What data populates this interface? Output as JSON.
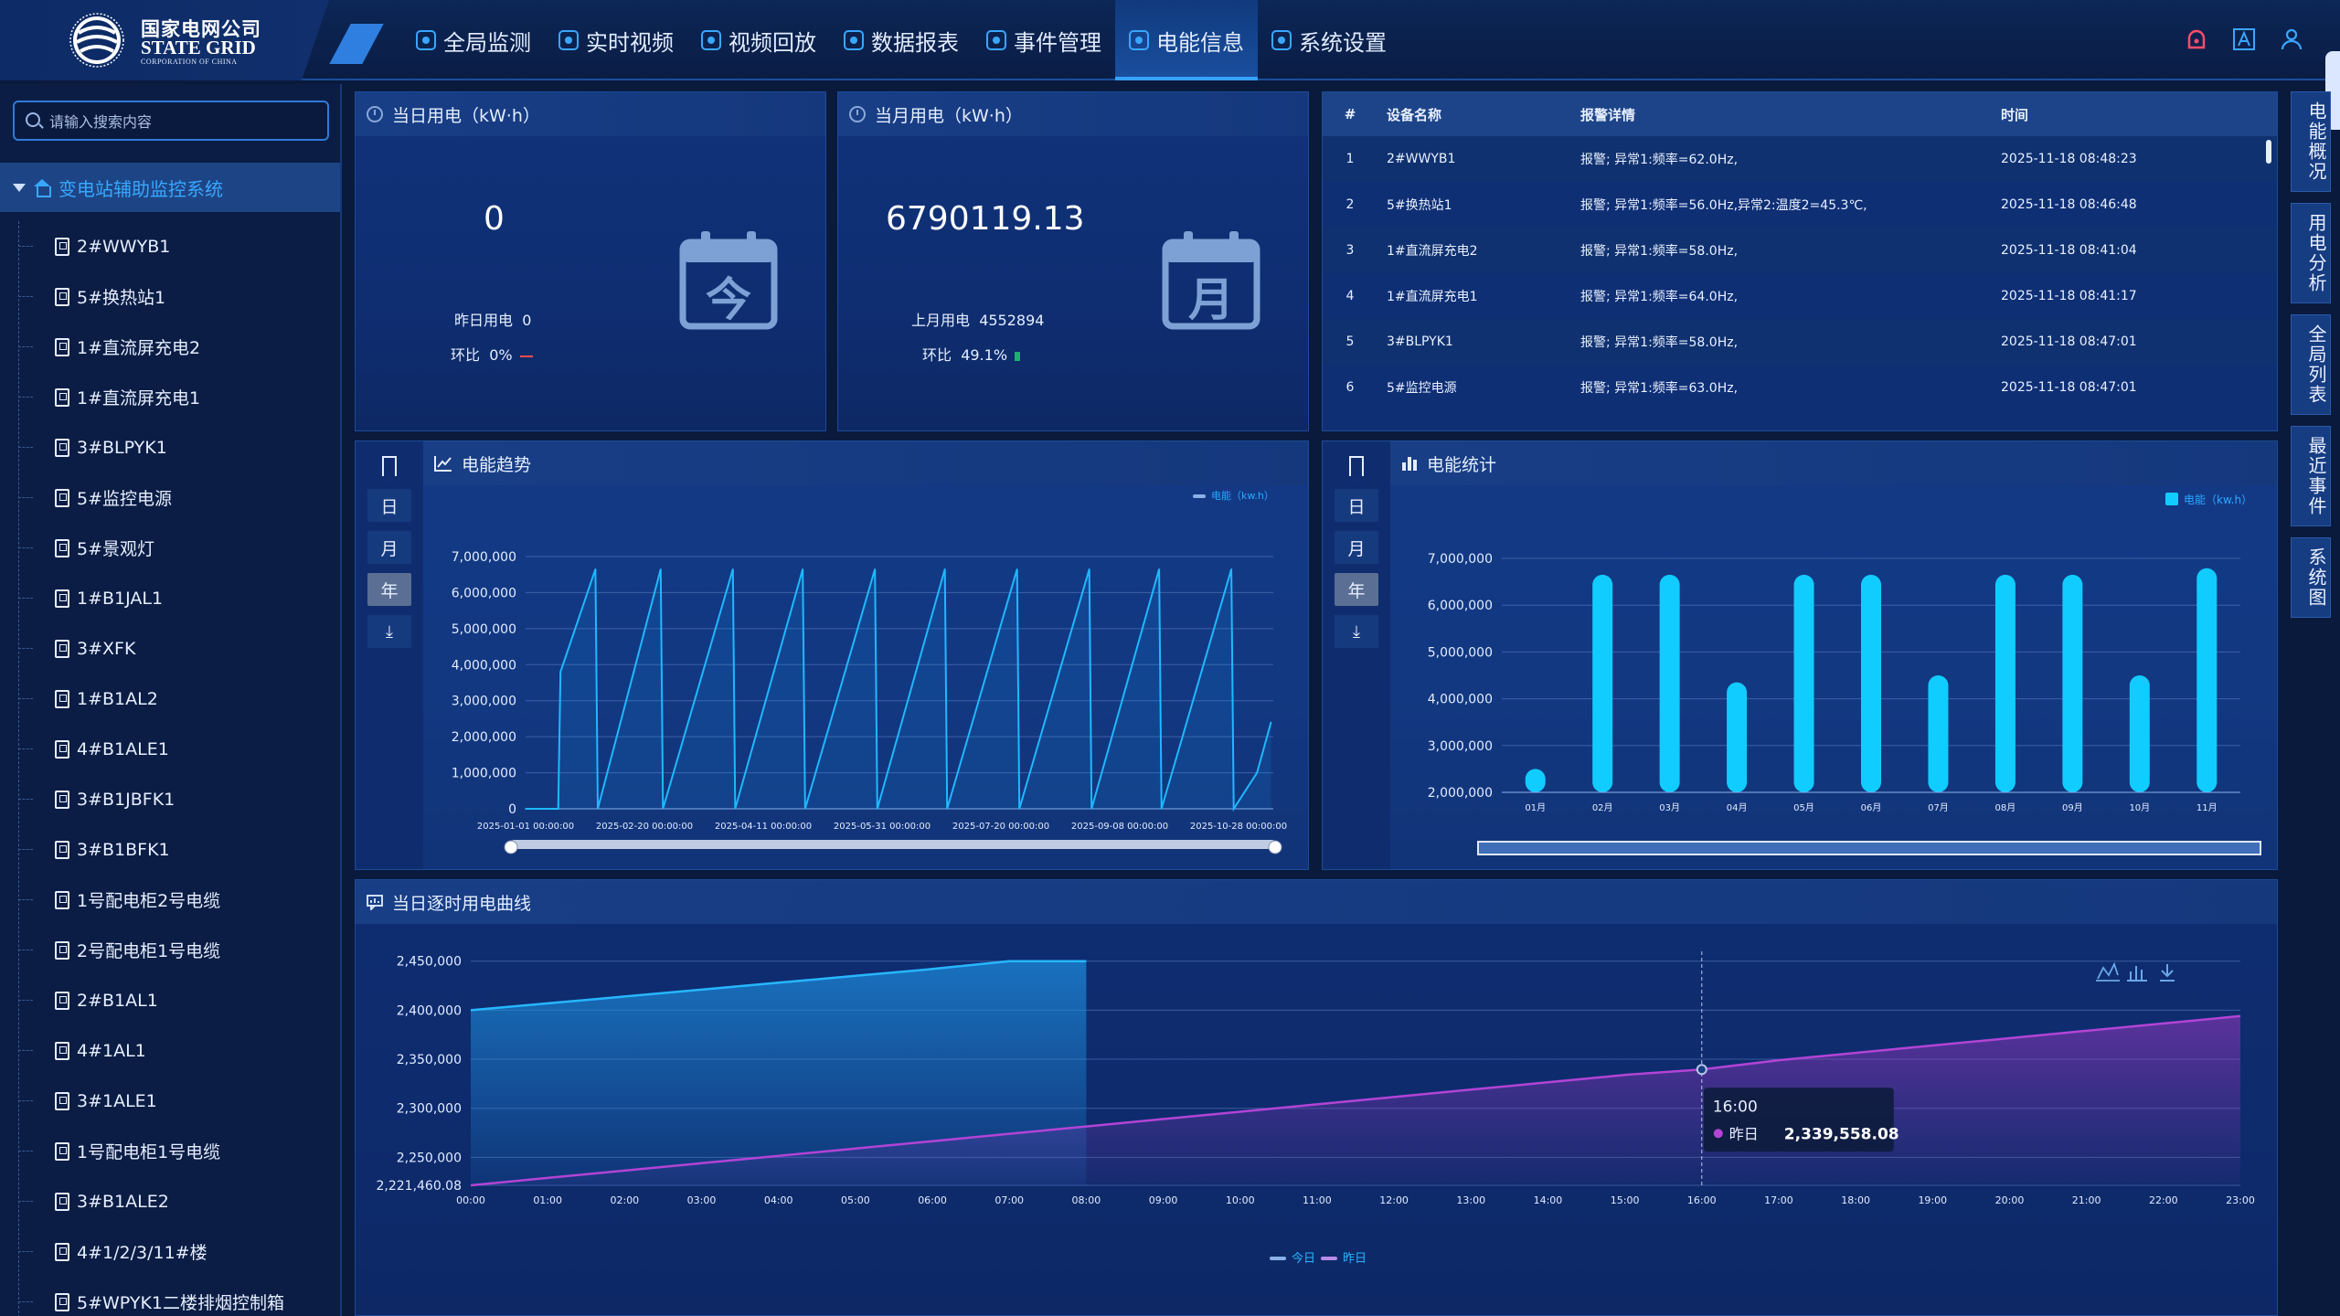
{
  "header": {
    "logo_cn": "国家电网公司",
    "logo_en": "STATE GRID",
    "logo_en_sub": "CORPORATION OF CHINA",
    "nav": [
      {
        "label": "全局监测"
      },
      {
        "label": "实时视频"
      },
      {
        "label": "视频回放"
      },
      {
        "label": "数据报表"
      },
      {
        "label": "事件管理"
      },
      {
        "label": "电能信息",
        "active": true
      },
      {
        "label": "系统设置"
      }
    ],
    "icons": [
      "alarm-icon",
      "font-a-icon",
      "user-icon"
    ]
  },
  "sidebar": {
    "search_placeholder": "请输入搜索内容",
    "root_label": "变电站辅助监控系统",
    "items": [
      "2#WWYB1",
      "5#换热站1",
      "1#直流屏充电2",
      "1#直流屏充电1",
      "3#BLPYK1",
      "5#监控电源",
      "5#景观灯",
      "1#B1JAL1",
      "3#XFK",
      "1#B1AL2",
      "4#B1ALE1",
      "3#B1JBFK1",
      "3#B1BFK1",
      "1号配电柜2号电缆",
      "2号配电柜1号电缆",
      "2#B1AL1",
      "4#1AL1",
      "3#1ALE1",
      "1号配电柜1号电缆",
      "3#B1ALE2",
      "4#1/2/3/11#楼",
      "5#WPYK1二楼排烟控制箱"
    ]
  },
  "today": {
    "title": "当日用电（kW·h）",
    "value": "0",
    "prev_label": "昨日用电",
    "prev_value": "0",
    "ratio_label": "环比",
    "ratio_value": "0%",
    "icon_char": "今"
  },
  "month": {
    "title": "当月用电（kW·h）",
    "value": "6790119.13",
    "prev_label": "上月用电",
    "prev_value": "4552894",
    "ratio_label": "环比",
    "ratio_value": "49.1%",
    "icon_char": "月"
  },
  "alarms": {
    "headers": {
      "idx": "#",
      "name": "设备名称",
      "detail": "报警详情",
      "time": "时间"
    },
    "rows": [
      {
        "idx": "1",
        "name": "2#WWYB1",
        "detail": "报警; 异常1:频率=62.0Hz,",
        "time": "2025-11-18 08:48:23"
      },
      {
        "idx": "2",
        "name": "5#换热站1",
        "detail": "报警; 异常1:频率=56.0Hz,异常2:温度2=45.3℃,",
        "time": "2025-11-18 08:46:48"
      },
      {
        "idx": "3",
        "name": "1#直流屏充电2",
        "detail": "报警; 异常1:频率=58.0Hz,",
        "time": "2025-11-18 08:41:04"
      },
      {
        "idx": "4",
        "name": "1#直流屏充电1",
        "detail": "报警; 异常1:频率=64.0Hz,",
        "time": "2025-11-18 08:41:17"
      },
      {
        "idx": "5",
        "name": "3#BLPYK1",
        "detail": "报警; 异常1:频率=58.0Hz,",
        "time": "2025-11-18 08:47:01"
      },
      {
        "idx": "6",
        "name": "5#监控电源",
        "detail": "报警; 异常1:频率=63.0Hz,",
        "time": "2025-11-18 08:47:01"
      }
    ]
  },
  "period_buttons": {
    "day": "日",
    "month": "月",
    "year": "年",
    "download": "⤓"
  },
  "trend": {
    "title": "电能趋势",
    "active_period": "年"
  },
  "stats": {
    "title": "电能统计",
    "active_period": "年"
  },
  "hourly": {
    "title": "当日逐时用电曲线"
  },
  "right_tabs": [
    "电能概况",
    "用电分析",
    "全局列表",
    "最近事件",
    "系统图"
  ],
  "chart_data": [
    {
      "type": "line",
      "title": "电能趋势",
      "series": [
        {
          "name": "电能（kw.h）",
          "color": "#1fb8ff"
        }
      ],
      "x_ticks": [
        "2025-01-01 00:00:00",
        "2025-02-20 00:00:00",
        "2025-04-11 00:00:00",
        "2025-05-31 00:00:00",
        "2025-07-20 00:00:00",
        "2025-09-08 00:00:00",
        "2025-10-28 00:00:00"
      ],
      "y_ticks": [
        "7,000,000",
        "6,000,000",
        "5,000,000",
        "4,000,000",
        "3,000,000",
        "2,000,000",
        "1,000,000",
        "0"
      ],
      "ylim": [
        0,
        7000000
      ],
      "xlim": [
        "2025-01-01",
        "2025-11-18"
      ],
      "points": [
        [
          "2025-01-01",
          0
        ],
        [
          "2025-01-15",
          0
        ],
        [
          "2025-01-16",
          3800000
        ],
        [
          "2025-01-31",
          6650000
        ],
        [
          "2025-02-01",
          0
        ],
        [
          "2025-02-28",
          6650000
        ],
        [
          "2025-03-01",
          0
        ],
        [
          "2025-03-31",
          6650000
        ],
        [
          "2025-04-01",
          0
        ],
        [
          "2025-04-30",
          6650000
        ],
        [
          "2025-05-01",
          0
        ],
        [
          "2025-05-31",
          6650000
        ],
        [
          "2025-06-01",
          0
        ],
        [
          "2025-06-30",
          6650000
        ],
        [
          "2025-07-01",
          0
        ],
        [
          "2025-07-31",
          6650000
        ],
        [
          "2025-08-01",
          0
        ],
        [
          "2025-08-31",
          6650000
        ],
        [
          "2025-09-01",
          0
        ],
        [
          "2025-09-30",
          6650000
        ],
        [
          "2025-10-01",
          0
        ],
        [
          "2025-10-31",
          6650000
        ],
        [
          "2025-11-01",
          0
        ],
        [
          "2025-11-11",
          1000000
        ],
        [
          "2025-11-17",
          2400000
        ]
      ],
      "grid": true,
      "legend": "top-right"
    },
    {
      "type": "bar",
      "title": "电能统计",
      "series": [
        {
          "name": "电能（kw.h）",
          "color": "#11ccff"
        }
      ],
      "categories": [
        "01月",
        "02月",
        "03月",
        "04月",
        "05月",
        "06月",
        "07月",
        "08月",
        "09月",
        "10月",
        "11月"
      ],
      "values": [
        2500000,
        6650000,
        6650000,
        4350000,
        6650000,
        6650000,
        4500000,
        6650000,
        6650000,
        4500000,
        6790119
      ],
      "y_ticks": [
        "7,000,000",
        "6,000,000",
        "5,000,000",
        "4,000,000",
        "3,000,000",
        "2,000,000"
      ],
      "ylim": [
        2000000,
        7000000
      ],
      "grid": true,
      "legend": "top-right"
    },
    {
      "type": "area",
      "title": "当日逐时用电曲线",
      "x": [
        "00:00",
        "01:00",
        "02:00",
        "03:00",
        "04:00",
        "05:00",
        "06:00",
        "07:00",
        "08:00",
        "09:00",
        "10:00",
        "11:00",
        "12:00",
        "13:00",
        "14:00",
        "15:00",
        "16:00",
        "17:00",
        "18:00",
        "19:00",
        "20:00",
        "21:00",
        "22:00",
        "23:00"
      ],
      "y_ticks": [
        "2,450,000",
        "2,400,000",
        "2,350,000",
        "2,300,000",
        "2,250,000",
        "2,221,460.08"
      ],
      "ylim": [
        2221460.08,
        2460000
      ],
      "series": [
        {
          "name": "今日",
          "color": "#27b6ff",
          "values": [
            2400000,
            2407000,
            2414000,
            2421000,
            2428000,
            2435000,
            2442000,
            2450000,
            2450000
          ]
        },
        {
          "name": "昨日",
          "color": "#b244d6",
          "values": [
            2221460.08,
            2229000,
            2236500,
            2244000,
            2251500,
            2259000,
            2266500,
            2274000,
            2281500,
            2289000,
            2296500,
            2304000,
            2311500,
            2319000,
            2326500,
            2334000,
            2339558.08,
            2349000,
            2356500,
            2364000,
            2371500,
            2379000,
            2386500,
            2394000
          ]
        }
      ],
      "tooltip": {
        "x": "16:00",
        "series": "昨日",
        "value": "2,339,558.08"
      },
      "grid": true,
      "legend": "bottom-center"
    }
  ]
}
